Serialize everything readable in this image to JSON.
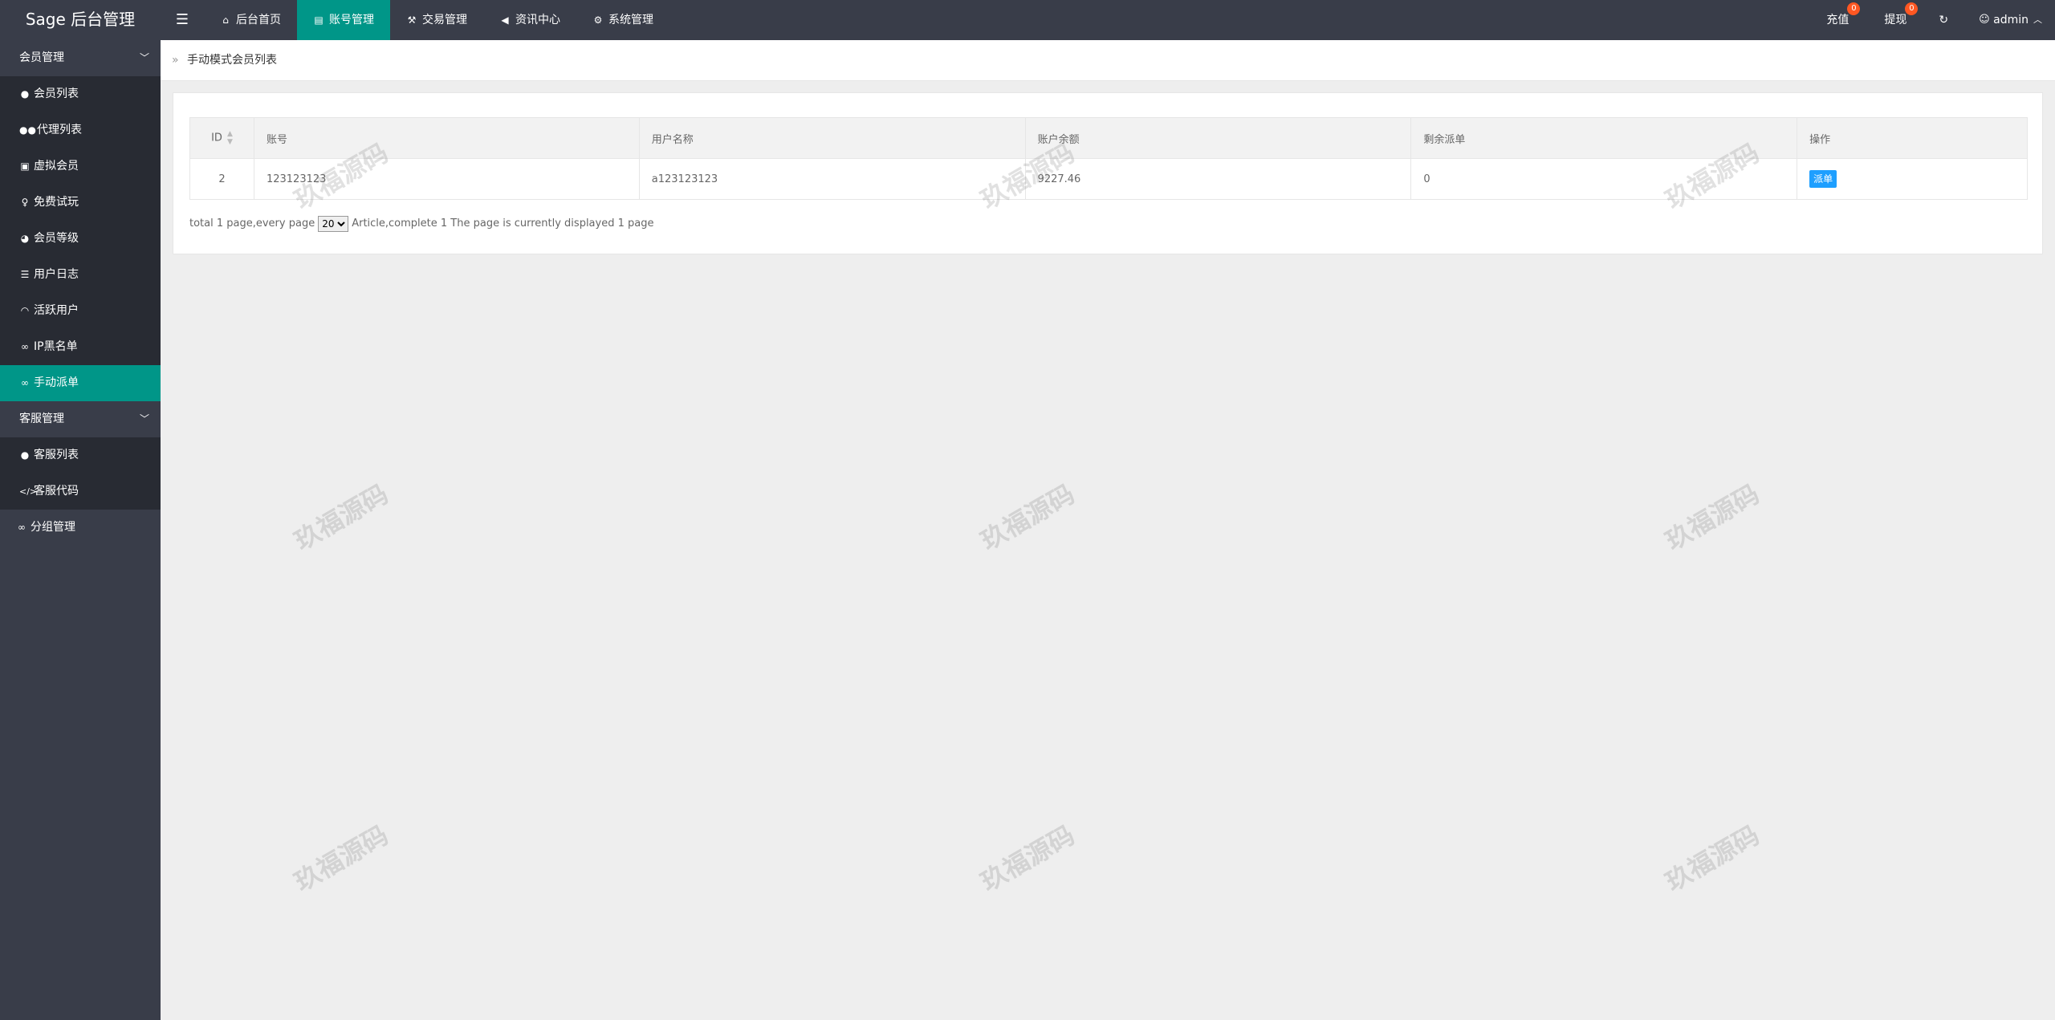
{
  "app": {
    "title": "Sage 后台管理"
  },
  "topnav": {
    "toggle_icon": "menu-icon",
    "items": [
      {
        "label": "后台首页",
        "icon": "home-icon",
        "active": false
      },
      {
        "label": "账号管理",
        "icon": "id-card-icon",
        "active": true
      },
      {
        "label": "交易管理",
        "icon": "gavel-icon",
        "active": false
      },
      {
        "label": "资讯中心",
        "icon": "bullhorn-icon",
        "active": false
      },
      {
        "label": "系统管理",
        "icon": "cogs-icon",
        "active": false
      }
    ],
    "right": {
      "recharge": {
        "label": "充值",
        "badge": "0"
      },
      "withdraw": {
        "label": "提现",
        "badge": "0"
      },
      "refresh_icon": "refresh-icon",
      "user": {
        "label": "admin",
        "icon": "user-icon"
      }
    }
  },
  "sidebar": {
    "groups": [
      {
        "label": "会员管理",
        "items": [
          {
            "label": "会员列表",
            "icon": "user-icon"
          },
          {
            "label": "代理列表",
            "icon": "users-icon"
          },
          {
            "label": "虚拟会员",
            "icon": "lock-icon"
          },
          {
            "label": "免费试玩",
            "icon": "person-icon"
          },
          {
            "label": "会员等级",
            "icon": "dashboard-icon"
          },
          {
            "label": "用户日志",
            "icon": "list-icon"
          },
          {
            "label": "活跃用户",
            "icon": "wifi-icon"
          },
          {
            "label": "IP黑名单",
            "icon": "link-icon"
          },
          {
            "label": "手动派单",
            "icon": "link-icon",
            "active": true
          }
        ]
      },
      {
        "label": "客服管理",
        "items": [
          {
            "label": "客服列表",
            "icon": "user-secret-icon"
          },
          {
            "label": "客服代码",
            "icon": "code-icon"
          }
        ]
      }
    ],
    "standalone": {
      "label": "分组管理",
      "icon": "link-icon"
    }
  },
  "breadcrumb": {
    "current": "手动模式会员列表"
  },
  "table": {
    "headers": [
      "ID",
      "账号",
      "用户名称",
      "账户余额",
      "剩余派单",
      "操作"
    ],
    "rows": [
      {
        "id": "2",
        "account": "123123123",
        "username": "a123123123",
        "balance": "9227.46",
        "remaining": "0",
        "action": "派单"
      }
    ]
  },
  "pager": {
    "prefix": "total 1 page,every page",
    "selected": "20",
    "suffix": "Article,complete 1 The page is currently displayed 1 page"
  },
  "watermark": {
    "text": "玖福源码"
  },
  "colors": {
    "header_bg": "#393d49",
    "active": "#009688",
    "badge": "#ff5722",
    "action_btn": "#1e9fff"
  }
}
